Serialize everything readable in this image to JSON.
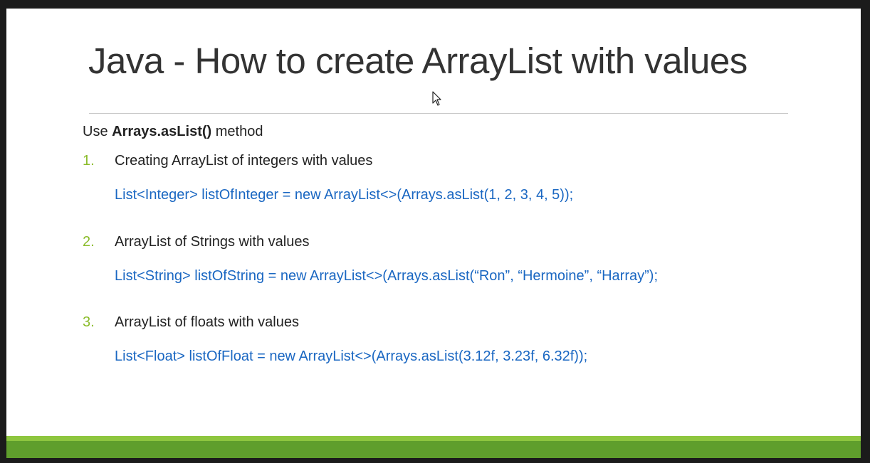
{
  "slide": {
    "title": "Java - How to create ArrayList with values",
    "intro_prefix": "Use ",
    "intro_bold": "Arrays.asList()",
    "intro_suffix": " method",
    "items": [
      {
        "number": "1.",
        "label": "Creating ArrayList of integers with values",
        "code": "List<Integer> listOfInteger = new ArrayList<>(Arrays.asList(1, 2, 3, 4, 5));"
      },
      {
        "number": "2.",
        "label": "ArrayList of Strings with values",
        "code": "List<String> listOfString = new ArrayList<>(Arrays.asList(“Ron”, “Hermoine”, “Harray”);"
      },
      {
        "number": "3.",
        "label": "ArrayList of floats with values",
        "code": "List<Float> listOfFloat = new ArrayList<>(Arrays.asList(3.12f, 3.23f, 6.32f));"
      }
    ]
  },
  "colors": {
    "number": "#8bbc2b",
    "code": "#1a67c2",
    "band_light": "#8ec63f",
    "band_dark": "#5f9e2c"
  },
  "icons": {
    "cursor": "mouse-pointer-icon"
  }
}
